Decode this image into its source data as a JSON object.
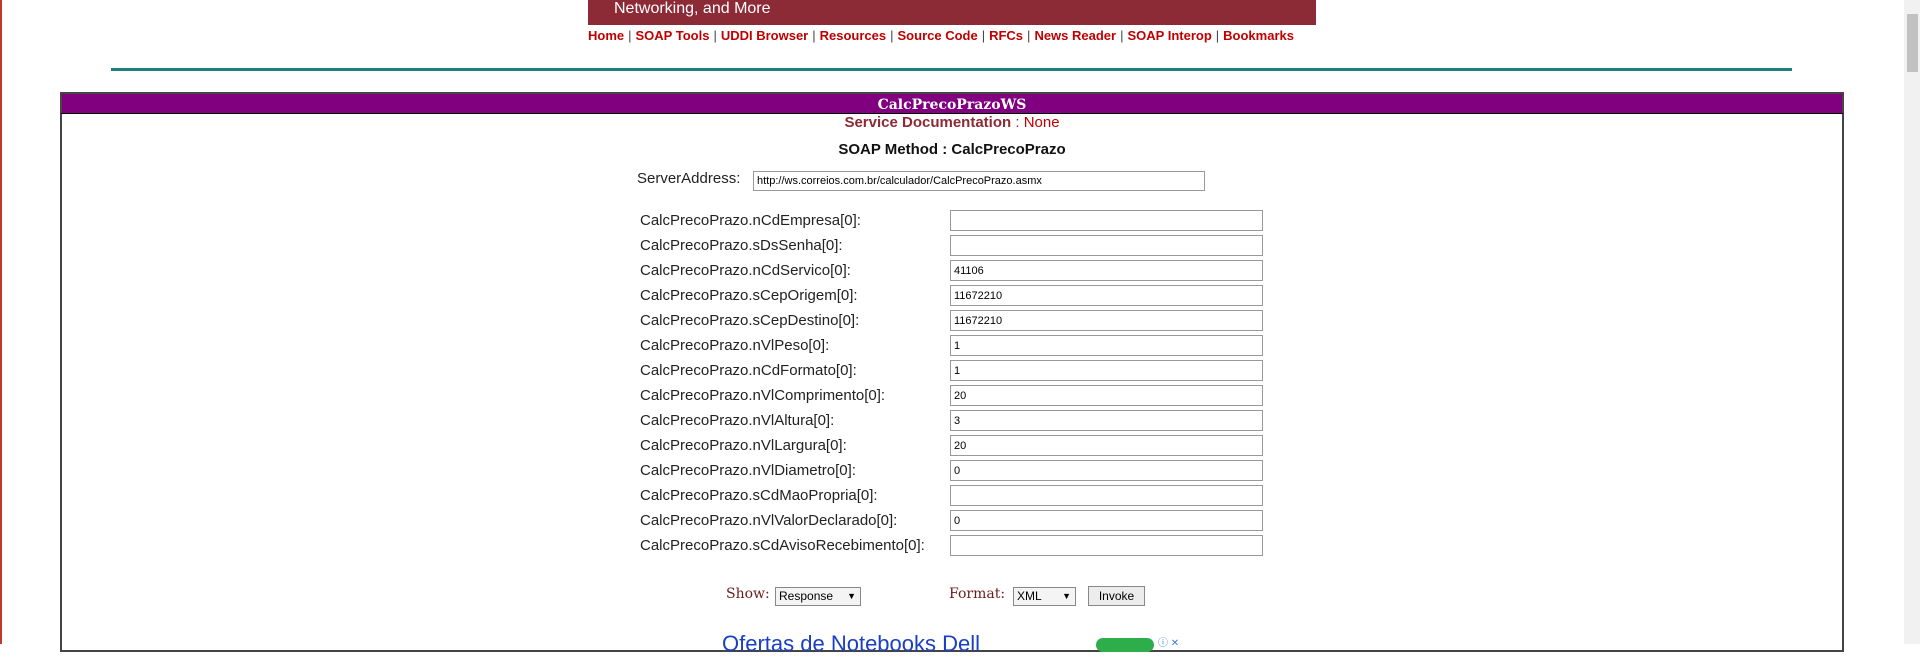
{
  "banner": {
    "text": "Networking, and More"
  },
  "nav": {
    "items": [
      "Home",
      "SOAP Tools",
      "UDDI Browser",
      "Resources",
      "Source Code",
      "RFCs",
      "News Reader",
      "SOAP Interop",
      "Bookmarks"
    ],
    "separator": "|"
  },
  "panel": {
    "title": "CalcPrecoPrazoWS",
    "doc_label": "Service Documentation",
    "doc_sep": " : ",
    "doc_value": "None",
    "method": "SOAP Method : CalcPrecoPrazo"
  },
  "server": {
    "label": "ServerAddress:",
    "value": "http://ws.correios.com.br/calculador/CalcPrecoPrazo.asmx"
  },
  "params": [
    {
      "label": "CalcPrecoPrazo.nCdEmpresa[0]:",
      "value": ""
    },
    {
      "label": "CalcPrecoPrazo.sDsSenha[0]:",
      "value": ""
    },
    {
      "label": "CalcPrecoPrazo.nCdServico[0]:",
      "value": "41106"
    },
    {
      "label": "CalcPrecoPrazo.sCepOrigem[0]:",
      "value": "11672210"
    },
    {
      "label": "CalcPrecoPrazo.sCepDestino[0]:",
      "value": "11672210"
    },
    {
      "label": "CalcPrecoPrazo.nVlPeso[0]:",
      "value": "1"
    },
    {
      "label": "CalcPrecoPrazo.nCdFormato[0]:",
      "value": "1"
    },
    {
      "label": "CalcPrecoPrazo.nVlComprimento[0]:",
      "value": "20"
    },
    {
      "label": "CalcPrecoPrazo.nVlAltura[0]:",
      "value": "3"
    },
    {
      "label": "CalcPrecoPrazo.nVlLargura[0]:",
      "value": "20"
    },
    {
      "label": "CalcPrecoPrazo.nVlDiametro[0]:",
      "value": "0"
    },
    {
      "label": "CalcPrecoPrazo.sCdMaoPropria[0]:",
      "value": ""
    },
    {
      "label": "CalcPrecoPrazo.nVlValorDeclarado[0]:",
      "value": "0"
    },
    {
      "label": "CalcPrecoPrazo.sCdAvisoRecebimento[0]:",
      "value": ""
    }
  ],
  "controls": {
    "show_label": "Show:",
    "show_value": "Response",
    "format_label": "Format:",
    "format_value": "XML",
    "invoke_label": "Invoke",
    "dropdown_glyph": "▼"
  },
  "ad": {
    "text": "Ofertas de Notebooks Dell",
    "icons": "ⓘ ✕"
  }
}
